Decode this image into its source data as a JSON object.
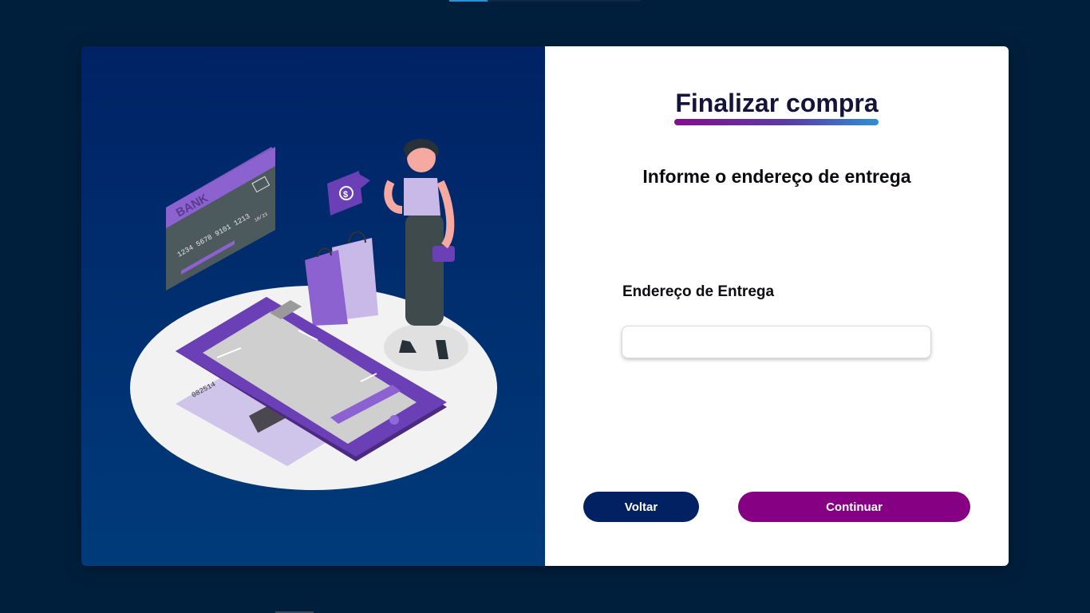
{
  "checkout": {
    "title": "Finalizar compra",
    "subtitle": "Informe o endereço de entrega",
    "address_label": "Endereço de Entrega",
    "address_value": "",
    "address_placeholder": "",
    "back_label": "Voltar",
    "continue_label": "Continuar"
  },
  "illustration": {
    "card_bank_text": "BANK",
    "card_number": "1234 5678 9101 1213",
    "card_expiry": "10/23",
    "ticket_number": "082514"
  },
  "colors": {
    "page_background": "#001f3d",
    "panel_gradient_top": "#002265",
    "panel_gradient_bottom": "#003b7a",
    "back_button": "#012163",
    "continue_button": "#850083",
    "accent_purple": "#6b3fb5"
  }
}
